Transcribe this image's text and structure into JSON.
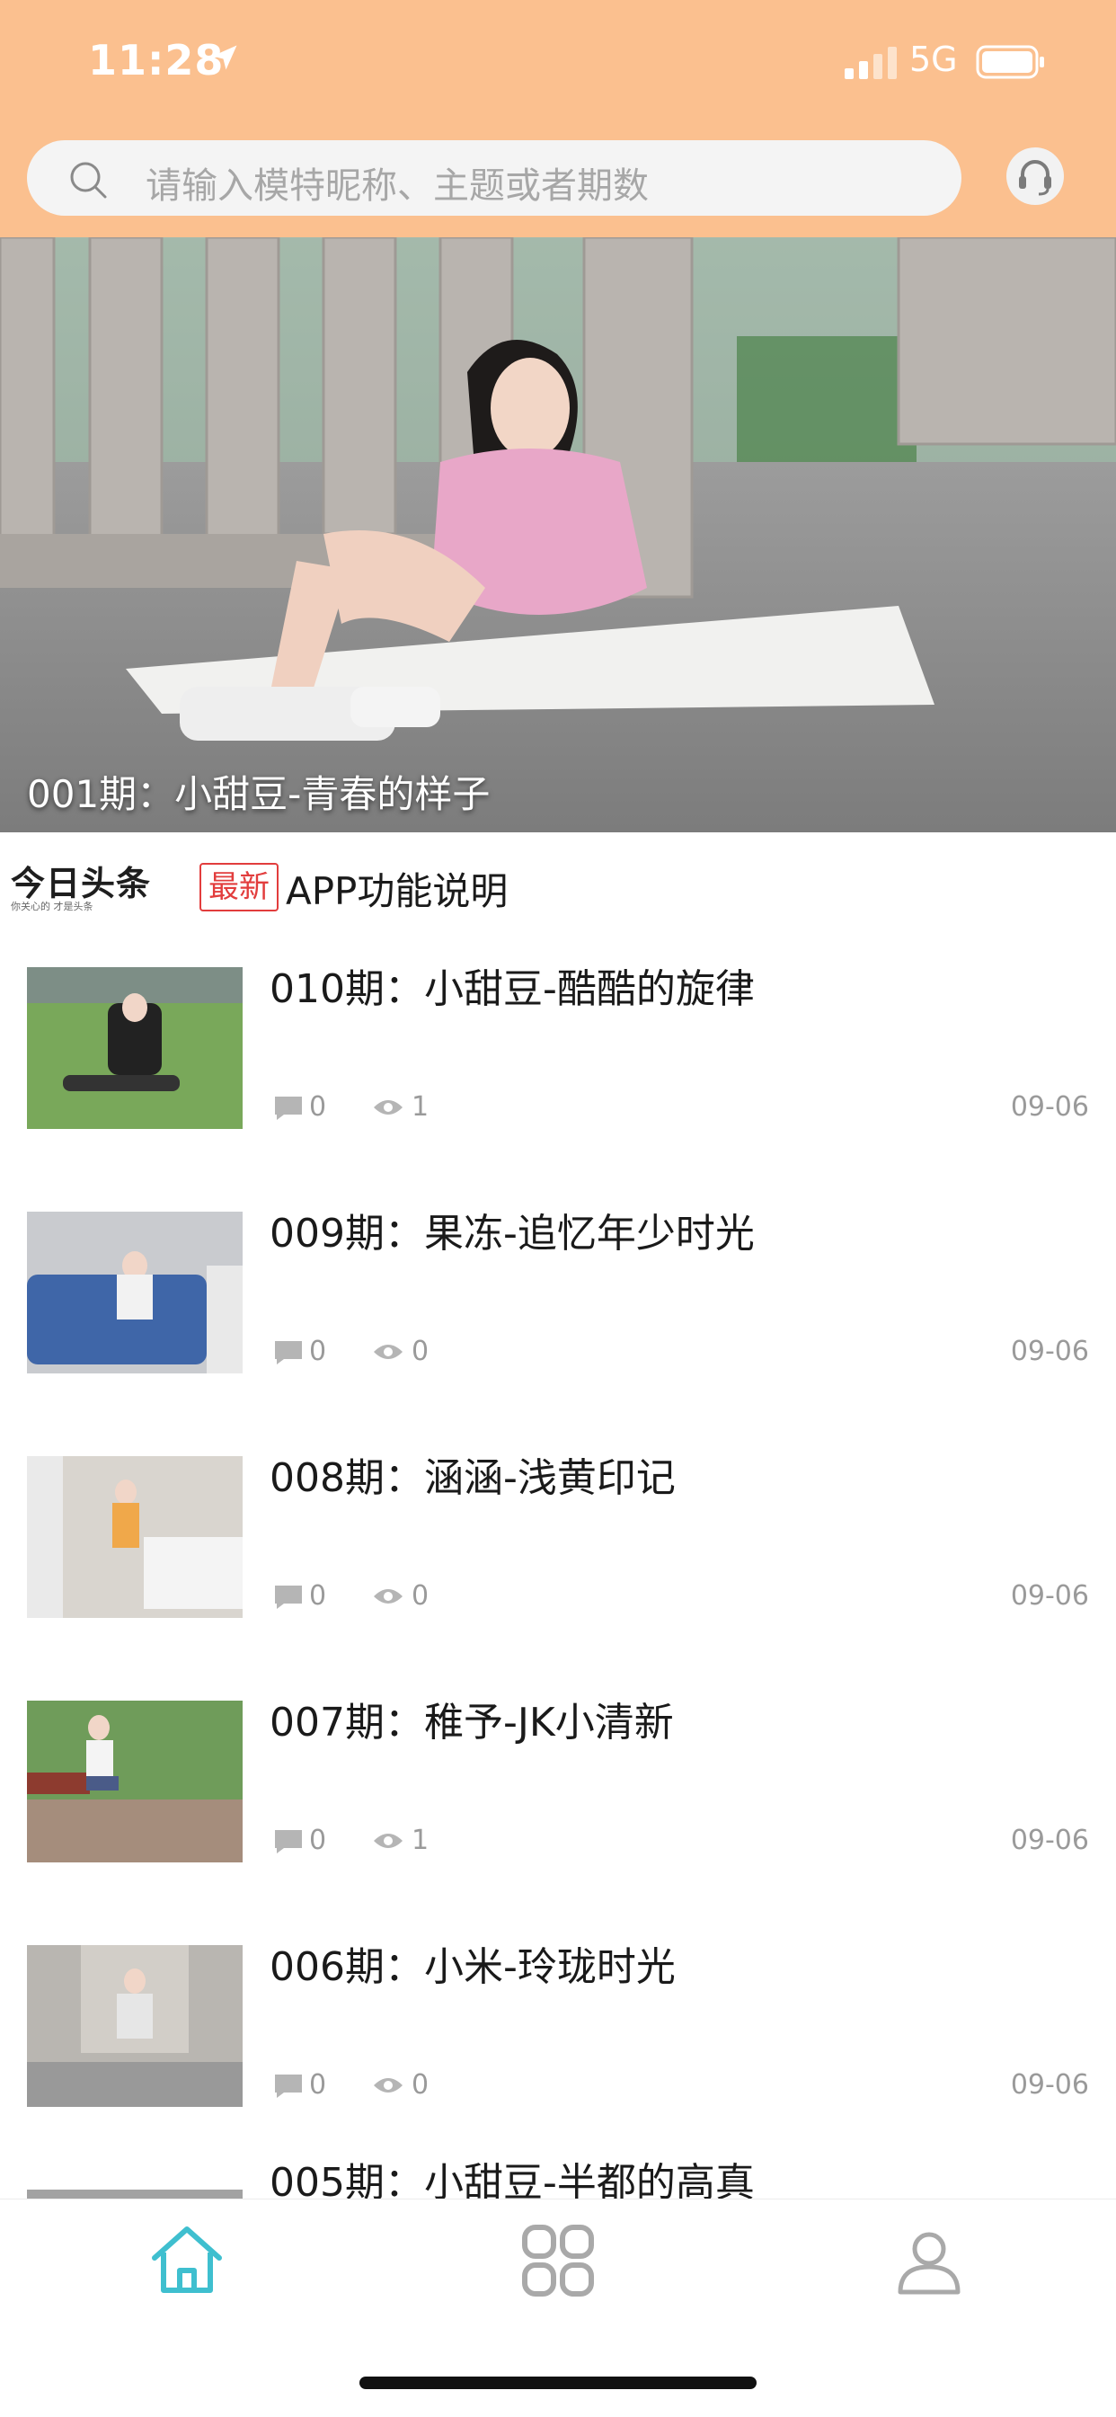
{
  "status_bar": {
    "time": "11:28",
    "network": "5G"
  },
  "search": {
    "placeholder": "请输入模特昵称、主题或者期数"
  },
  "banner": {
    "caption": "001期：小甜豆-青春的样子"
  },
  "news": {
    "logo": "今日头条",
    "logo_sub": "你关心的 才是头条",
    "badge": "最新",
    "text": "APP功能说明"
  },
  "list": {
    "items": [
      {
        "title": "010期：小甜豆-酷酷的旋律",
        "comments": "0",
        "views": "1",
        "date": "09-06"
      },
      {
        "title": "009期：果冻-追忆年少时光",
        "comments": "0",
        "views": "0",
        "date": "09-06"
      },
      {
        "title": "008期：涵涵-浅黄印记",
        "comments": "0",
        "views": "0",
        "date": "09-06"
      },
      {
        "title": "007期：稚予-JK小清新",
        "comments": "0",
        "views": "1",
        "date": "09-06"
      },
      {
        "title": "006期：小米-玲珑时光",
        "comments": "0",
        "views": "0",
        "date": "09-06"
      },
      {
        "title": "005期：小甜豆-半都的高真",
        "comments": "",
        "views": "",
        "date": ""
      }
    ]
  },
  "tabbar": {
    "tabs": [
      {
        "icon": "home-icon",
        "active": true
      },
      {
        "icon": "category-icon",
        "active": false
      },
      {
        "icon": "profile-icon",
        "active": false
      }
    ],
    "active_color": "#3fbfcf",
    "inactive_color": "#a9a9a9"
  },
  "colors": {
    "header": "#fbc08f",
    "badge": "#e23d3d"
  }
}
